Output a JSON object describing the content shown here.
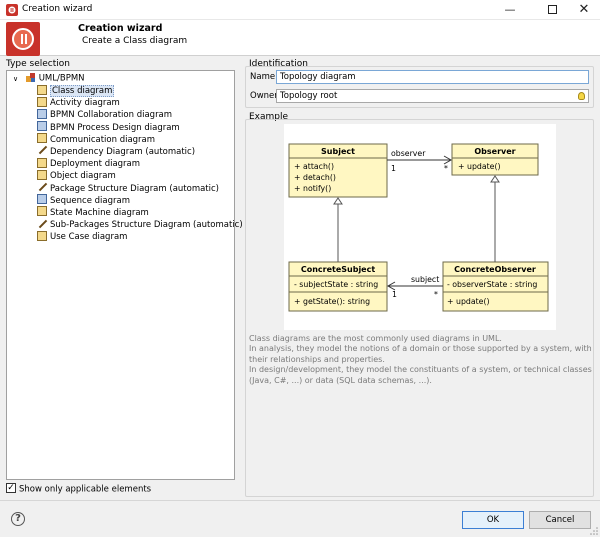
{
  "window": {
    "title": "Creation wizard",
    "minimize_glyph": "—",
    "close_glyph": "✕"
  },
  "header": {
    "title": "Creation wizard",
    "subtitle": "Create a Class diagram"
  },
  "type_selection": {
    "label": "Type selection",
    "root": {
      "label": "UML/BPMN",
      "expanded": true
    },
    "items": [
      {
        "label": "Class diagram",
        "icon": "class-diagram-icon",
        "selected": true
      },
      {
        "label": "Activity diagram",
        "icon": "activity-diagram-icon"
      },
      {
        "label": "BPMN Collaboration diagram",
        "icon": "bpmn-collaboration-icon"
      },
      {
        "label": "BPMN Process Design diagram",
        "icon": "bpmn-process-icon"
      },
      {
        "label": "Communication diagram",
        "icon": "communication-diagram-icon"
      },
      {
        "label": "Dependency Diagram (automatic)",
        "icon": "dependency-diagram-icon"
      },
      {
        "label": "Deployment diagram",
        "icon": "deployment-diagram-icon"
      },
      {
        "label": "Object diagram",
        "icon": "object-diagram-icon"
      },
      {
        "label": "Package Structure Diagram (automatic)",
        "icon": "package-structure-icon"
      },
      {
        "label": "Sequence diagram",
        "icon": "sequence-diagram-icon"
      },
      {
        "label": "State Machine diagram",
        "icon": "state-machine-icon"
      },
      {
        "label": "Sub-Packages Structure Diagram (automatic)",
        "icon": "sub-packages-icon"
      },
      {
        "label": "Use Case diagram",
        "icon": "use-case-icon"
      }
    ],
    "show_only_label": "Show only applicable elements",
    "show_only_checked": true
  },
  "identification": {
    "label": "Identification",
    "name_label": "Name",
    "name_value": "Topology diagram",
    "owner_label": "Owner",
    "owner_value": "Topology root"
  },
  "example": {
    "label": "Example",
    "diagram": {
      "subject": {
        "name": "Subject",
        "ops": [
          "+ attach()",
          "+ detach()",
          "+ notify()"
        ]
      },
      "observer": {
        "name": "Observer",
        "ops": [
          "+ update()"
        ]
      },
      "concrete_subject": {
        "name": "ConcreteSubject",
        "attrs": [
          "- subjectState : string"
        ],
        "ops": [
          "+ getState(): string"
        ]
      },
      "concrete_observer": {
        "name": "ConcreteObserver",
        "attrs": [
          "- observerState : string"
        ],
        "ops": [
          "+ update()"
        ]
      },
      "assoc_top": {
        "role": "observer",
        "mult_src": "1",
        "mult_dst": "*"
      },
      "assoc_bottom": {
        "role": "subject",
        "mult_src": "*",
        "mult_dst": "1"
      }
    },
    "description": [
      "Class diagrams are the most commonly used diagrams in UML.",
      "In analysis, they model the notions of a domain or those supported by a system, with their relationships and properties.",
      "In design/development, they model the constituants of a system, or technical classes (Java, C#, ...) or data (SQL data schemas, ...)."
    ]
  },
  "footer": {
    "help_glyph": "?",
    "ok_label": "OK",
    "cancel_label": "Cancel"
  },
  "colors": {
    "class_fill": "#fff7c2",
    "class_stroke": "#6e6a4a",
    "selection": "#dbe6f5",
    "ok_border": "#3c7fd4"
  }
}
